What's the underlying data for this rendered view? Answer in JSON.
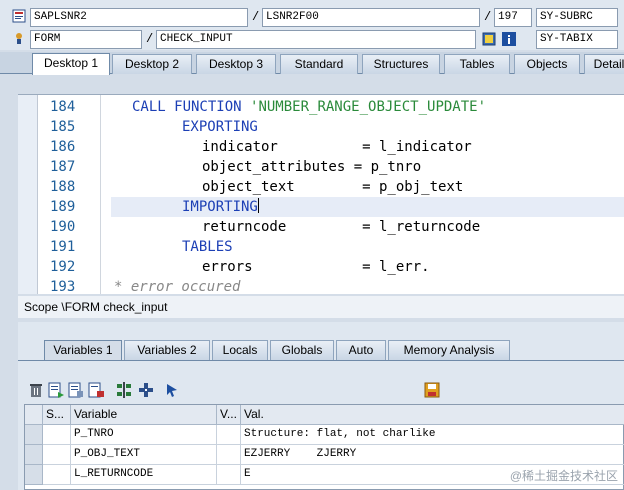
{
  "header": {
    "program": "SAPLSNR2",
    "include": "LSNR2F00",
    "line": "197",
    "sysvar1": "SY-SUBRC",
    "event": "FORM",
    "routine": "CHECK_INPUT",
    "sysvar2": "SY-TABIX",
    "sep": "/"
  },
  "top_tabs": [
    "Desktop 1",
    "Desktop 2",
    "Desktop 3",
    "Standard",
    "Structures",
    "Tables",
    "Objects",
    "Detail"
  ],
  "editor": {
    "lines": [
      {
        "num": "184",
        "text": "CALL FUNCTION 'NUMBER_RANGE_OBJECT_UPDATE'"
      },
      {
        "num": "185",
        "text": "EXPORTING"
      },
      {
        "num": "186",
        "text": "indicator          = l_indicator"
      },
      {
        "num": "187",
        "text": "object_attributes = p_tnro"
      },
      {
        "num": "188",
        "text": "object_text        = p_obj_text"
      },
      {
        "num": "189",
        "text": "IMPORTING"
      },
      {
        "num": "190",
        "text": "returncode         = l_returncode"
      },
      {
        "num": "191",
        "text": "TABLES"
      },
      {
        "num": "192",
        "text": "errors             = l_err."
      },
      {
        "num": "193",
        "text": "* error occured"
      }
    ]
  },
  "scope": "Scope \\FORM check_input",
  "bottom_tabs": [
    "Variables 1",
    "Variables 2",
    "Locals",
    "Globals",
    "Auto",
    "Memory Analysis"
  ],
  "grid": {
    "headers": [
      "S...",
      "Variable",
      "V...",
      "Val."
    ],
    "rows": [
      {
        "variable": "P_TNRO",
        "value": "Structure: flat, not charlike"
      },
      {
        "variable": "P_OBJ_TEXT",
        "value": "EZJERRY    ZJERRY"
      },
      {
        "variable": "L_RETURNCODE",
        "value": "E"
      }
    ]
  },
  "watermark": "@稀土掘金技术社区",
  "colors": {
    "keyword": "#1c3fb5",
    "string": "#2a8a3a",
    "linenum": "#1f5f9a"
  }
}
